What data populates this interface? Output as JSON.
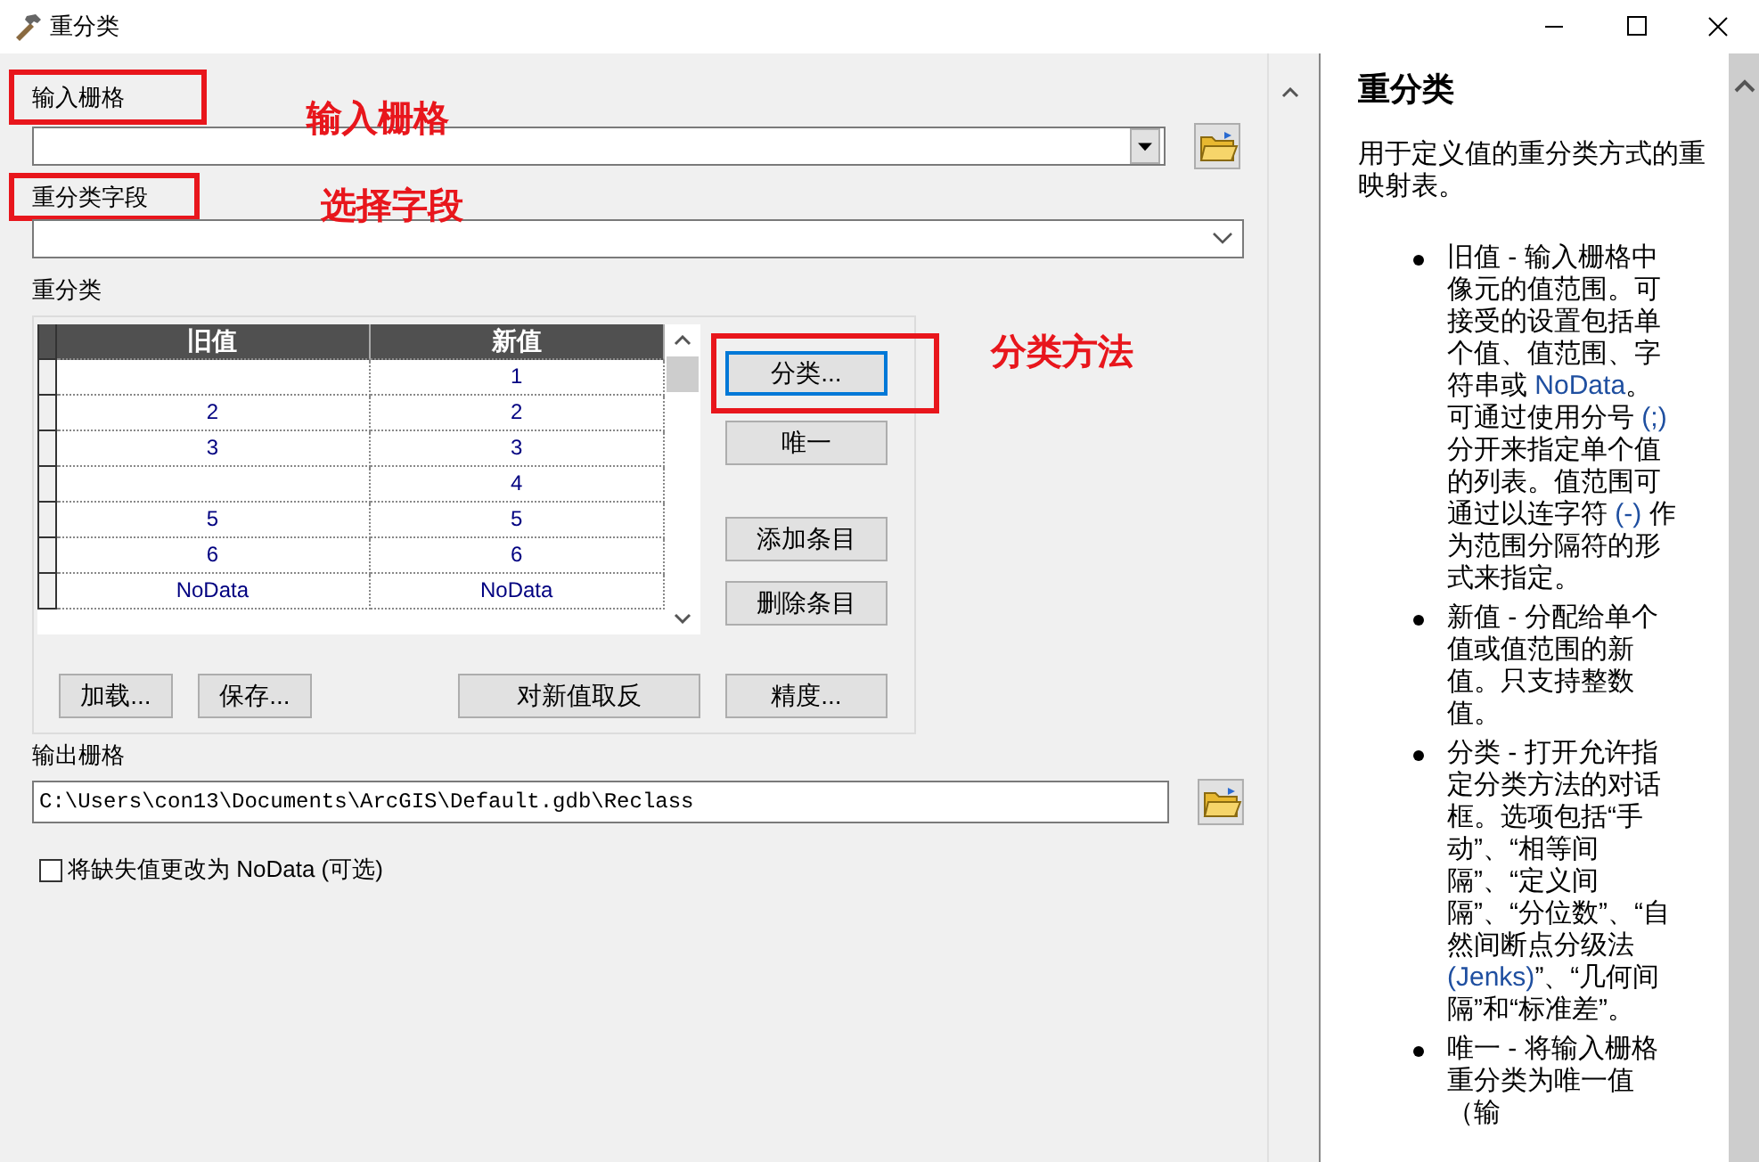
{
  "window": {
    "title": "重分类"
  },
  "input_raster": {
    "label": "输入栅格"
  },
  "reclass_field": {
    "label": "重分类字段"
  },
  "reclassification": {
    "label": "重分类",
    "columns": [
      "旧值",
      "新值"
    ],
    "rows": [
      {
        "new": "1"
      },
      {
        "old": "2",
        "new": "2"
      },
      {
        "old": "3",
        "new": "3"
      },
      {
        "new": "4"
      },
      {
        "old": "5",
        "new": "5"
      },
      {
        "old": "6",
        "new": "6"
      },
      {
        "old": "NoData",
        "new": "NoData"
      }
    ],
    "side_buttons": [
      {
        "label": "分类...",
        "focused": true
      },
      {
        "label": "唯一",
        "focused": false
      },
      {
        "label": "添加条目",
        "focused": false
      },
      {
        "label": "删除条目",
        "focused": false
      }
    ],
    "bottom_buttons": [
      "加载...",
      "保存...",
      "对新值取反",
      "精度..."
    ]
  },
  "output_raster": {
    "label": "输出栅格",
    "value": "C:\\Users\\con13\\Documents\\ArcGIS\\Default.gdb\\Reclass"
  },
  "missing_to_nodata": {
    "label": "将缺失值更改为 NoData (可选)",
    "checked": false
  },
  "help": {
    "title": "重分类",
    "intro": "用于定义值的重分类方式的重映射表。",
    "bullets": [
      [
        {
          "text": "旧值 - 输入栅格中像元的值范围。可接受的设置包括单个值、值范围、字符串或 "
        },
        {
          "text": "NoData",
          "kind": "term"
        },
        {
          "text": "。可通过使用分号 "
        },
        {
          "text": "(;)",
          "kind": "term"
        },
        {
          "text": " 分开来指定单个值的列表。值范围可通过以连字符 "
        },
        {
          "text": "(-)",
          "kind": "term"
        },
        {
          "text": " 作为范围分隔符的形式来指定。"
        }
      ],
      [
        {
          "text": "新值 - 分配给单个值或值范围的新值。只支持整数值。"
        }
      ],
      [
        {
          "text": "分类 - 打开允许指定分类方法的对话框。选项包括“手动”、“相等间隔”、“定义间隔”、“分位数”、“自然间断点分级法 "
        },
        {
          "text": "(Jenks)",
          "kind": "term"
        },
        {
          "text": "”、“几何间隔”和“标准差”。"
        }
      ],
      [
        {
          "text": "唯一 - 将输入栅格重分类为唯一值（输"
        }
      ]
    ]
  },
  "annotations": [
    "输入栅格",
    "选择字段",
    "分类方法"
  ]
}
